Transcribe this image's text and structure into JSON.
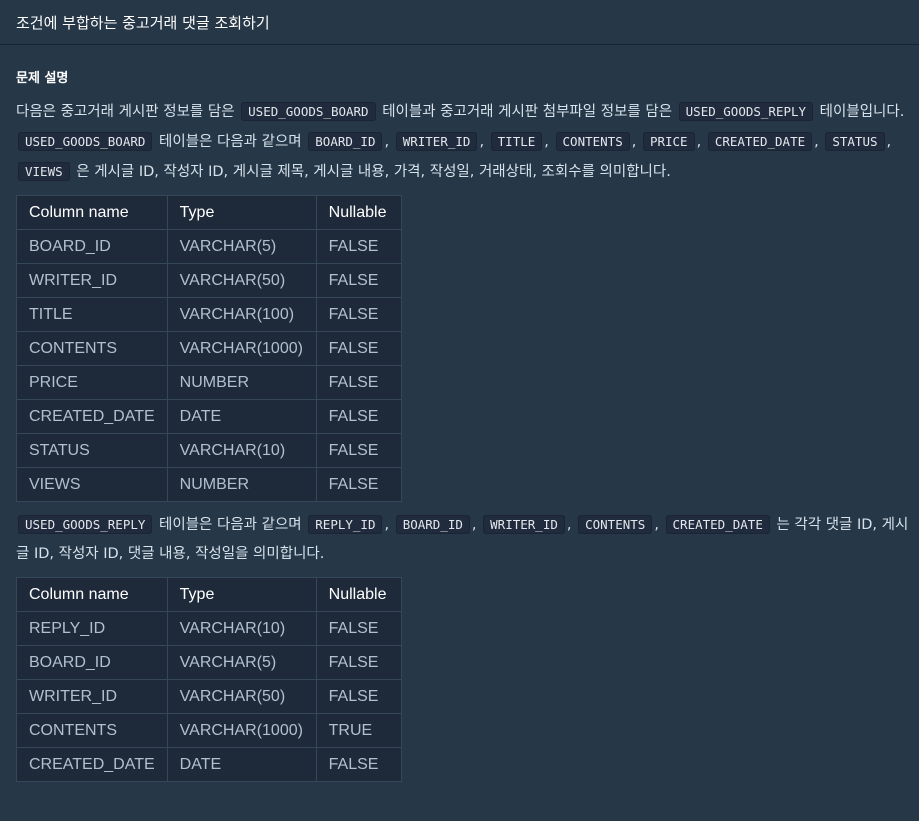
{
  "header": {
    "title": "조건에 부합하는 중고거래 댓글 조회하기"
  },
  "section": {
    "heading": "문제 설명"
  },
  "para1": {
    "t1": "다음은 중고거래 게시판 정보를 담은",
    "c1": "USED_GOODS_BOARD",
    "t2": "테이블과 중고거래 게시판 첨부파일 정보를 담은",
    "c2": "USED_GOODS_REPLY",
    "t3": "테이블입니다.",
    "c3": "USED_GOODS_BOARD",
    "t4": "테이블은 다음과 같으며",
    "c4": "BOARD_ID",
    "c5": "WRITER_ID",
    "c6": "TITLE",
    "c7": "CONTENTS",
    "c8": "PRICE",
    "c9": "CREATED_DATE",
    "c10": "STATUS",
    "c11": "VIEWS",
    "t5": "은 게시글 ID, 작성자 ID, 게시글 제목, 게시글 내용, 가격, 작성일, 거래상태, 조회수를 의미합니다."
  },
  "table1": {
    "headers": [
      "Column name",
      "Type",
      "Nullable"
    ],
    "rows": [
      [
        "BOARD_ID",
        "VARCHAR(5)",
        "FALSE"
      ],
      [
        "WRITER_ID",
        "VARCHAR(50)",
        "FALSE"
      ],
      [
        "TITLE",
        "VARCHAR(100)",
        "FALSE"
      ],
      [
        "CONTENTS",
        "VARCHAR(1000)",
        "FALSE"
      ],
      [
        "PRICE",
        "NUMBER",
        "FALSE"
      ],
      [
        "CREATED_DATE",
        "DATE",
        "FALSE"
      ],
      [
        "STATUS",
        "VARCHAR(10)",
        "FALSE"
      ],
      [
        "VIEWS",
        "NUMBER",
        "FALSE"
      ]
    ]
  },
  "para2": {
    "c1": "USED_GOODS_REPLY",
    "t1": "테이블은 다음과 같으며",
    "c2": "REPLY_ID",
    "c3": "BOARD_ID",
    "c4": "WRITER_ID",
    "c5": "CONTENTS",
    "c6": "CREATED_DATE",
    "t2": "는 각각 댓글 ID, 게시글 ID, 작성자 ID, 댓글 내용, 작성일을 의미합니다."
  },
  "table2": {
    "headers": [
      "Column name",
      "Type",
      "Nullable"
    ],
    "rows": [
      [
        "REPLY_ID",
        "VARCHAR(10)",
        "FALSE"
      ],
      [
        "BOARD_ID",
        "VARCHAR(5)",
        "FALSE"
      ],
      [
        "WRITER_ID",
        "VARCHAR(50)",
        "FALSE"
      ],
      [
        "CONTENTS",
        "VARCHAR(1000)",
        "TRUE"
      ],
      [
        "CREATED_DATE",
        "DATE",
        "FALSE"
      ]
    ]
  }
}
